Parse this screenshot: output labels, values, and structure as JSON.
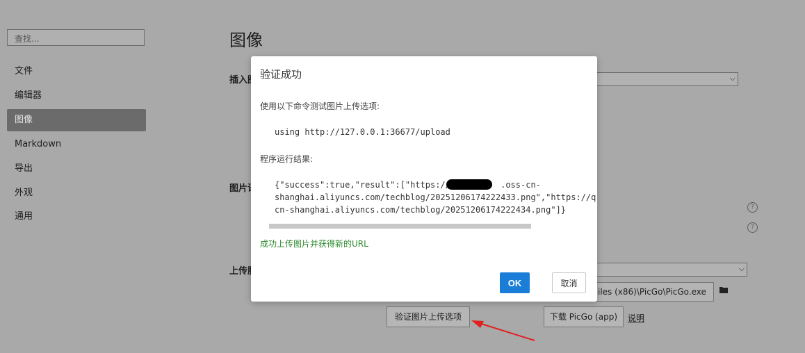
{
  "sidebar": {
    "search_placeholder": "查找...",
    "items": [
      {
        "label": "文件"
      },
      {
        "label": "编辑器"
      },
      {
        "label": "图像",
        "active": true
      },
      {
        "label": "Markdown"
      },
      {
        "label": "导出"
      },
      {
        "label": "外观"
      },
      {
        "label": "通用"
      }
    ]
  },
  "main": {
    "title": "图像",
    "section_insert_label": "插入图",
    "section_syntax_label": "图片语",
    "section_upload_label": "上传服",
    "picgo_path": "iles (x86)\\PicGo\\PicGo.exe",
    "verify_button_label": "验证图片上传选项",
    "download_picgo_label": "下载 PicGo (app)",
    "help_link_label": "说明"
  },
  "dialog": {
    "title": "验证成功",
    "intro_text": "使用以下命令测试图片上传选项:",
    "command": "using http://127.0.0.1:36677/upload",
    "result_label": "程序运行结果:",
    "result_line1": "{\"success\":true,\"result\":[\"https://          .oss-cn-",
    "result_line2": "shanghai.aliyuncs.com/techblog/20251206174222433.png\",\"https://q",
    "result_line3": "cn-shanghai.aliyuncs.com/techblog/20251206174222434.png\"]}",
    "success_message": "成功上传图片并获得新的URL",
    "ok_label": "OK",
    "cancel_label": "取消"
  },
  "colors": {
    "overlay_bg": "#a9a9a9",
    "ok_button": "#1a7dd7",
    "success_text": "#2e8b2e",
    "arrow": "#e02020"
  }
}
